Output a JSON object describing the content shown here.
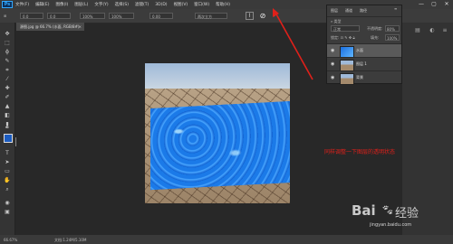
{
  "menubar": {
    "logo": "Ps",
    "items": [
      "文件(F)",
      "编辑(E)",
      "图像(I)",
      "图层(L)",
      "文字(Y)",
      "选择(S)",
      "滤镜(T)",
      "3D(D)",
      "视图(V)",
      "窗口(W)",
      "帮助(H)"
    ],
    "window_controls": [
      "—",
      "▢",
      "✕"
    ]
  },
  "options": {
    "x_value": "0.0",
    "y_value": "0.0",
    "w_value": "100%",
    "h_value": "100%",
    "angle_value": "0.00",
    "interp_value": "两次立方"
  },
  "document": {
    "tab_title": "源图.jpg @ 66.7% (水面, RGB/8#)",
    "close": "×"
  },
  "layers": {
    "tabs": [
      "图层",
      "通道",
      "路径"
    ],
    "blend_mode": "正常",
    "opacity_label": "不透明度:",
    "opacity_value": "80%",
    "fill_label": "填充:",
    "fill_value": "100%",
    "rows": [
      {
        "name": "水面",
        "selected": true
      },
      {
        "name": "图层 1",
        "selected": false
      },
      {
        "name": "背景",
        "selected": false
      }
    ]
  },
  "annotation": {
    "text": "同样调整一下图层的透明状态",
    "color": "#e0201a"
  },
  "status": {
    "zoom": "66.67%",
    "doc_info": "文档:1.24M/5.10M"
  },
  "watermark": {
    "brand": "Bai",
    "brand2": "经验",
    "url": "jingyan.baidu.com"
  },
  "colors": {
    "foreground": "#1c5cc0",
    "background": "#ffffff",
    "accent": "#31a8ff"
  },
  "icons": {
    "warp": "warp-icon",
    "cancel": "cancel-icon",
    "commit": "commit-icon"
  }
}
